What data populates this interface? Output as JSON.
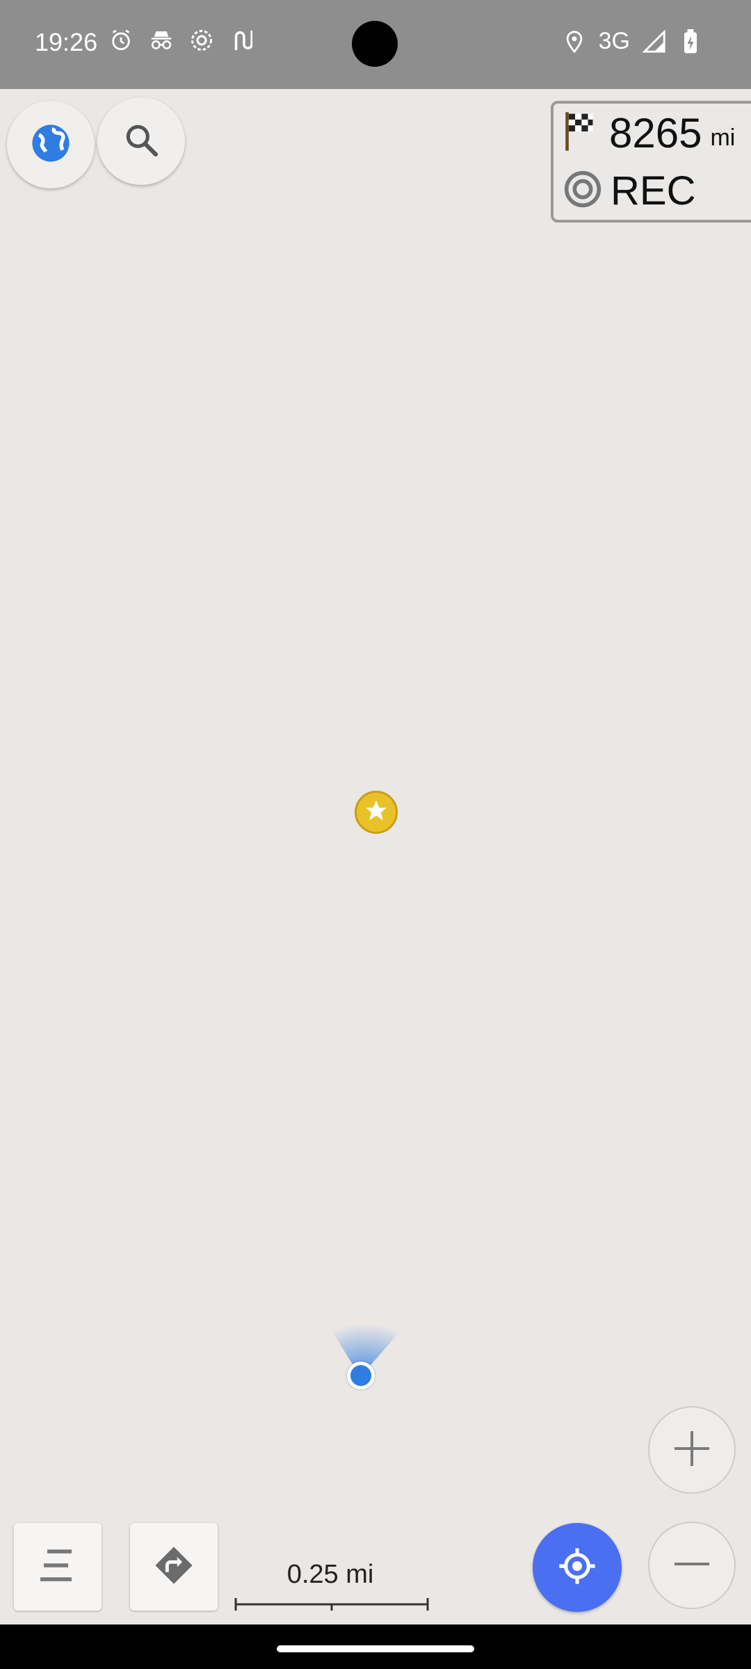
{
  "status_bar": {
    "time": "19:26",
    "icons_left": [
      "alarm-icon",
      "incognito-icon",
      "settings-gear-icon",
      "route-icon"
    ],
    "network": "3G",
    "icons_right": [
      "location-pin-icon",
      "signal-icon",
      "battery-charging-icon"
    ],
    "background": "#8e8e8e"
  },
  "map": {
    "background": "#eae7e4",
    "markers": [
      {
        "type": "favorite",
        "icon": "star-icon",
        "color": "#e9c229"
      },
      {
        "type": "my-location",
        "color": "#2f7de1"
      }
    ]
  },
  "widgets": {
    "distance": {
      "value": "8265",
      "unit": "mi",
      "icon": "checkered-flag-icon"
    },
    "recording": {
      "label": "REC",
      "icon": "record-icon"
    }
  },
  "buttons": {
    "globe": "globe-icon",
    "search": "search-icon",
    "zoom_in": "plus-icon",
    "zoom_out": "minus-icon",
    "menu": "menu-icon",
    "directions": "directions-icon",
    "my_location": "crosshair-location-icon",
    "accent_color": "#4a6ff0"
  },
  "scale": {
    "label": "0.25 mi"
  }
}
